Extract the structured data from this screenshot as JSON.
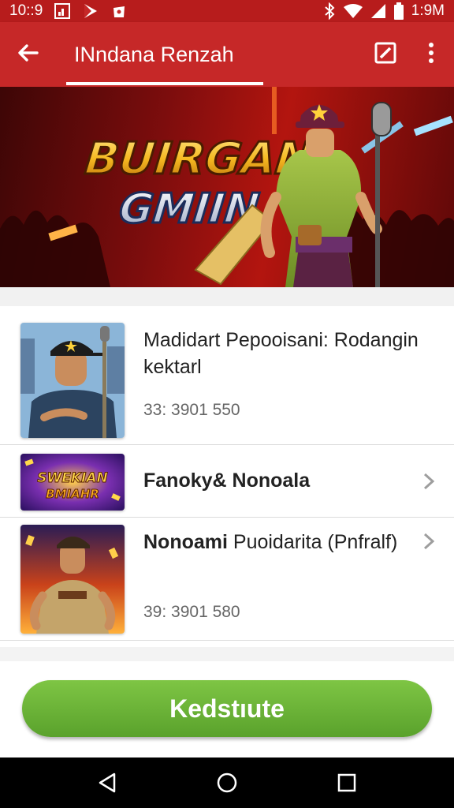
{
  "status_bar": {
    "time_left": "10::9",
    "time_right": "1:9M"
  },
  "app_bar": {
    "title": "INndana Renzah",
    "back_icon": "arrow-back-icon",
    "edit_icon": "edit-square-icon",
    "more_icon": "more-vert-icon"
  },
  "hero": {
    "title_line1": "BUIRGAN",
    "title_line2": "GMIIN"
  },
  "list": {
    "items": [
      {
        "title": "Madidart Pepooisani: Rodangin kektarl",
        "meta": "33: 3901 550"
      },
      {
        "title": "Fanoky& Nonoala",
        "thumb_text_1": "SWEKIAN",
        "thumb_text_2": "BMIAHR"
      },
      {
        "title_bold": "Nonoami",
        "title_rest": " Puoidarita (Pnfralf)",
        "meta": "39: 3901 580"
      }
    ]
  },
  "cta": {
    "label": "Kedstıute",
    "color": "#6cb33a"
  },
  "colors": {
    "primary": "#c62828",
    "status": "#b71c1c"
  }
}
